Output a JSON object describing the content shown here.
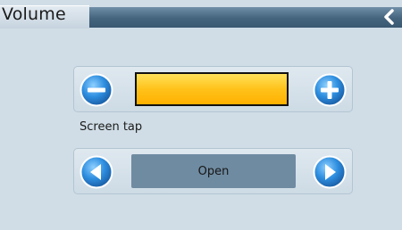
{
  "header": {
    "title": "Volume",
    "back_icon": "chevron-left-icon"
  },
  "volume": {
    "level": 1.0,
    "decrease_icon": "minus-circle-icon",
    "increase_icon": "plus-circle-icon",
    "bar_color": "#ffc21a"
  },
  "screen_tap": {
    "label": "Screen tap",
    "value": "Open",
    "prev_icon": "arrow-left-circle-icon",
    "next_icon": "arrow-right-circle-icon"
  },
  "colors": {
    "accent": "#2f8fe0",
    "panel_bg": "#d0dde6",
    "value_box": "#6f8ba1"
  }
}
